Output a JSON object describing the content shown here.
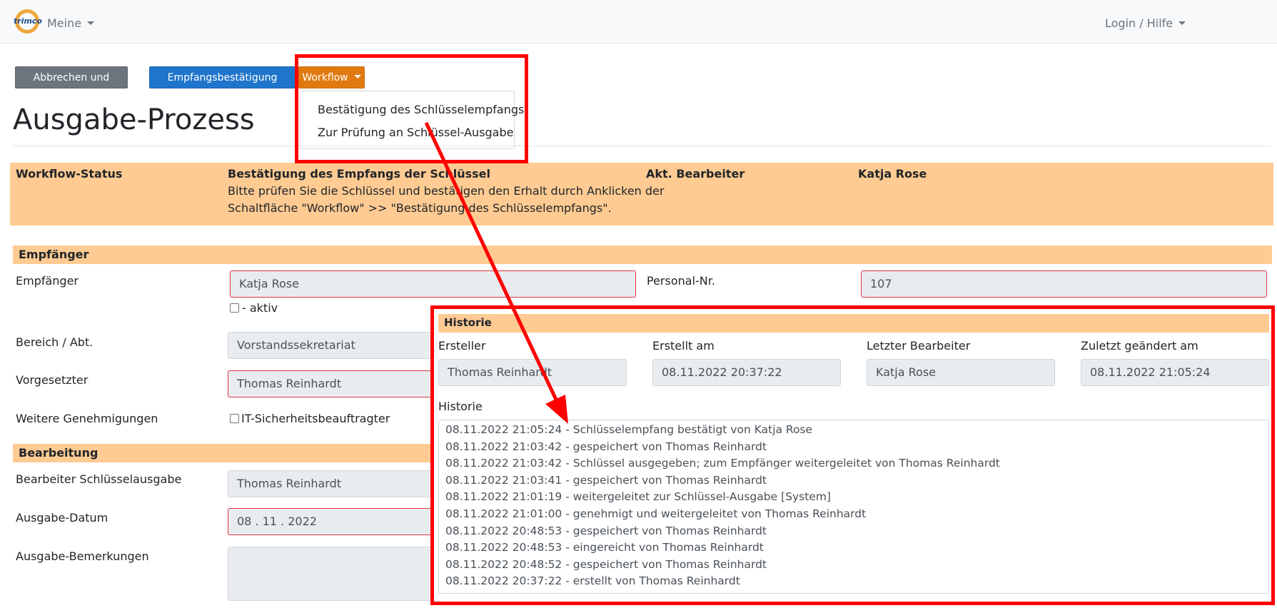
{
  "navbar": {
    "logo_text": "trimco",
    "left_menu": "Meine",
    "right_menu": "Login / Hilfe"
  },
  "toolbar": {
    "cancel_label": "Abbrechen und zurück",
    "confirm_label": "Empfangsbestätigung erstellen",
    "workflow_label": "Workflow"
  },
  "workflow_menu": {
    "items": [
      "Bestätigung des Schlüsselempfangs",
      "Zur Prüfung an Schlüssel-Ausgabe"
    ]
  },
  "page": {
    "title": "Ausgabe-Prozess"
  },
  "status": {
    "label": "Workflow-Status",
    "heading": "Bestätigung des Empfangs der Schlüssel",
    "line1": "Bitte prüfen Sie die Schlüssel und bestätigen den Erhalt durch Anklicken der",
    "line2": "Schaltfläche \"Workflow\" >> \"Bestätigung des Schlüsselempfangs\".",
    "editor_label": "Akt. Bearbeiter",
    "editor_value": "Katja Rose"
  },
  "empfaenger": {
    "section": "Empfänger",
    "recipient_label": "Empfänger",
    "recipient_value": "Katja Rose",
    "active_label": "- aktiv",
    "personal_label": "Personal-Nr.",
    "personal_value": "107",
    "bereich_label": "Bereich / Abt.",
    "bereich_value": "Vorstandssekretariat",
    "vorgesetzter_label": "Vorgesetzter",
    "vorgesetzter_value": "Thomas Reinhardt",
    "weitere_label": "Weitere Genehmigungen",
    "it_label": "IT-Sicherheitsbeauftragter"
  },
  "bearbeitung": {
    "section": "Bearbeitung",
    "bearbeiter_label": "Bearbeiter Schlüsselausgabe",
    "bearbeiter_value": "Thomas Reinhardt",
    "datum_label": "Ausgabe-Datum",
    "datum_value": "08 . 11 . 2022",
    "bemerkungen_label": "Ausgabe-Bemerkungen"
  },
  "historie": {
    "section": "Historie",
    "ersteller_label": "Ersteller",
    "ersteller_value": "Thomas Reinhardt",
    "erstellt_label": "Erstellt am",
    "erstellt_value": "08.11.2022 20:37:22",
    "letzter_label": "Letzter Bearbeiter",
    "letzter_value": "Katja Rose",
    "geaendert_label": "Zuletzt geändert am",
    "geaendert_value": "08.11.2022 21:05:24",
    "list_label": "Historie",
    "entries": [
      "08.11.2022 21:05:24 - Schlüsselempfang bestätigt von Katja Rose",
      "08.11.2022 21:03:42 - gespeichert von Thomas Reinhardt",
      "08.11.2022 21:03:42 - Schlüssel ausgegeben; zum Empfänger weitergeleitet von Thomas Reinhardt",
      "08.11.2022 21:03:41 - gespeichert von Thomas Reinhardt",
      "08.11.2022 21:01:19 - weitergeleitet zur Schlüssel-Ausgabe [System]",
      "08.11.2022 21:01:00 - genehmigt und weitergeleitet von Thomas Reinhardt",
      "08.11.2022 20:48:53 - gespeichert von Thomas Reinhardt",
      "08.11.2022 20:48:53 - eingereicht von Thomas Reinhardt",
      "08.11.2022 20:48:52 - gespeichert von Thomas Reinhardt",
      "08.11.2022 20:37:22 - erstellt von Thomas Reinhardt"
    ]
  },
  "colors": {
    "accent_orange": "#e07a10",
    "band": "#ffcb93",
    "annotation_red": "#ff0000",
    "primary_blue": "#1f75cb"
  }
}
